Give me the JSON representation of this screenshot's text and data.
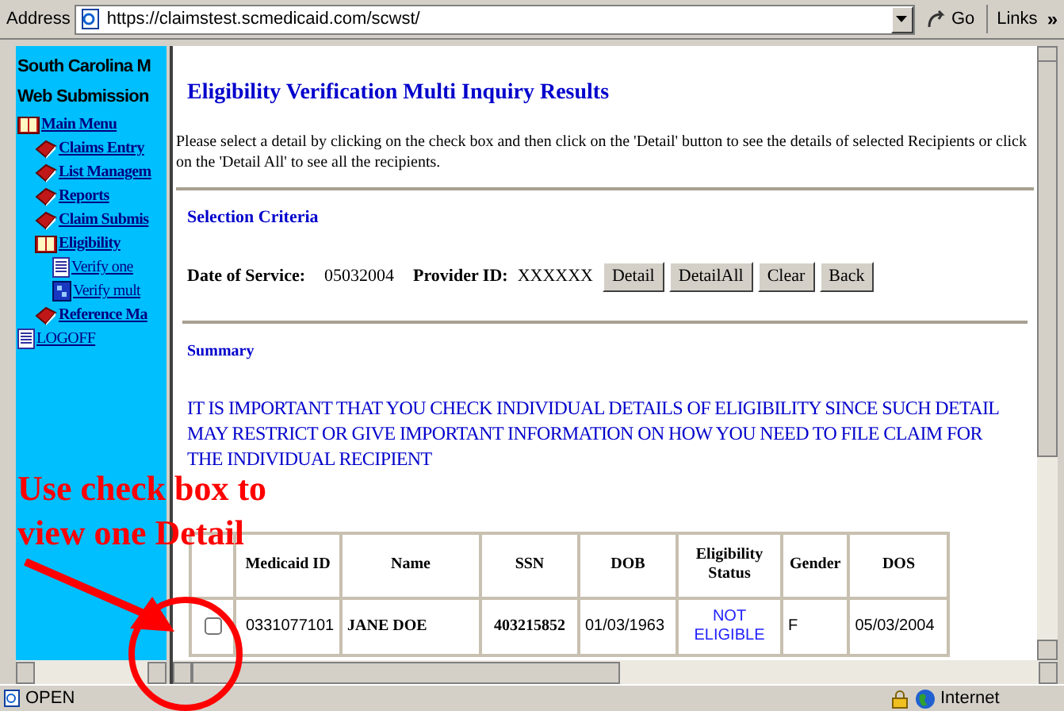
{
  "address_bar": {
    "label": "Address",
    "url": "https://claimstest.scmedicaid.com/scwst/",
    "go": "Go",
    "links": "Links",
    "links_more": "»"
  },
  "sidebar": {
    "title_lines": [
      "South Carolina M",
      "Web Submission"
    ],
    "items": [
      {
        "label": "Main Menu",
        "kind": "open-book",
        "bold": true,
        "children": [
          {
            "label": "Claims Entry",
            "kind": "book",
            "bold": true
          },
          {
            "label": "List Managem",
            "kind": "book",
            "bold": true
          },
          {
            "label": "Reports",
            "kind": "book",
            "bold": true
          },
          {
            "label": "Claim Submis",
            "kind": "book",
            "bold": true
          },
          {
            "label": "Eligibility",
            "kind": "open-book",
            "bold": true,
            "children": [
              {
                "label": "Verify one",
                "kind": "page",
                "bold": false
              },
              {
                "label": "Verify mult",
                "kind": "multi",
                "bold": false
              }
            ]
          },
          {
            "label": "Reference Ma",
            "kind": "book",
            "bold": true
          }
        ]
      },
      {
        "label": "LOGOFF",
        "kind": "page",
        "bold": false
      }
    ]
  },
  "main": {
    "title": "Eligibility Verification Multi Inquiry Results",
    "instructions": "Please select a detail by clicking on the check box and then click on the 'Detail' button to see the details of selected Recipients or click on the 'Detail All' to see all the recipients.",
    "selection_criteria": {
      "heading": "Selection Criteria",
      "date_label": "Date of Service:",
      "date_value": "05032004",
      "provider_label": "Provider ID:",
      "provider_value": "XXXXXX",
      "buttons": [
        "Detail",
        "DetailAll",
        "Clear",
        "Back"
      ]
    },
    "summary": {
      "heading": "Summary",
      "notice": "IT IS IMPORTANT THAT YOU CHECK INDIVIDUAL DETAILS OF ELIGIBILITY SINCE SUCH DETAIL MAY RESTRICT OR GIVE IMPORTANT INFORMATION ON HOW YOU NEED TO FILE CLAIM FOR THE INDIVIDUAL RECIPIENT"
    },
    "table": {
      "columns": [
        "Medicaid ID",
        "Name",
        "SSN",
        "DOB",
        "Eligibility Status",
        "Gender",
        "DOS"
      ],
      "rows": [
        {
          "checked": false,
          "cells": [
            "0331077101",
            "JANE DOE",
            "403215852",
            "01/03/1963",
            "NOT ELIGIBLE",
            "F",
            "05/03/2004"
          ]
        }
      ]
    }
  },
  "annotation": {
    "lines": [
      "Use check box to",
      "view one Detail"
    ]
  },
  "status_bar": {
    "text": "OPEN",
    "zone": "Internet"
  }
}
